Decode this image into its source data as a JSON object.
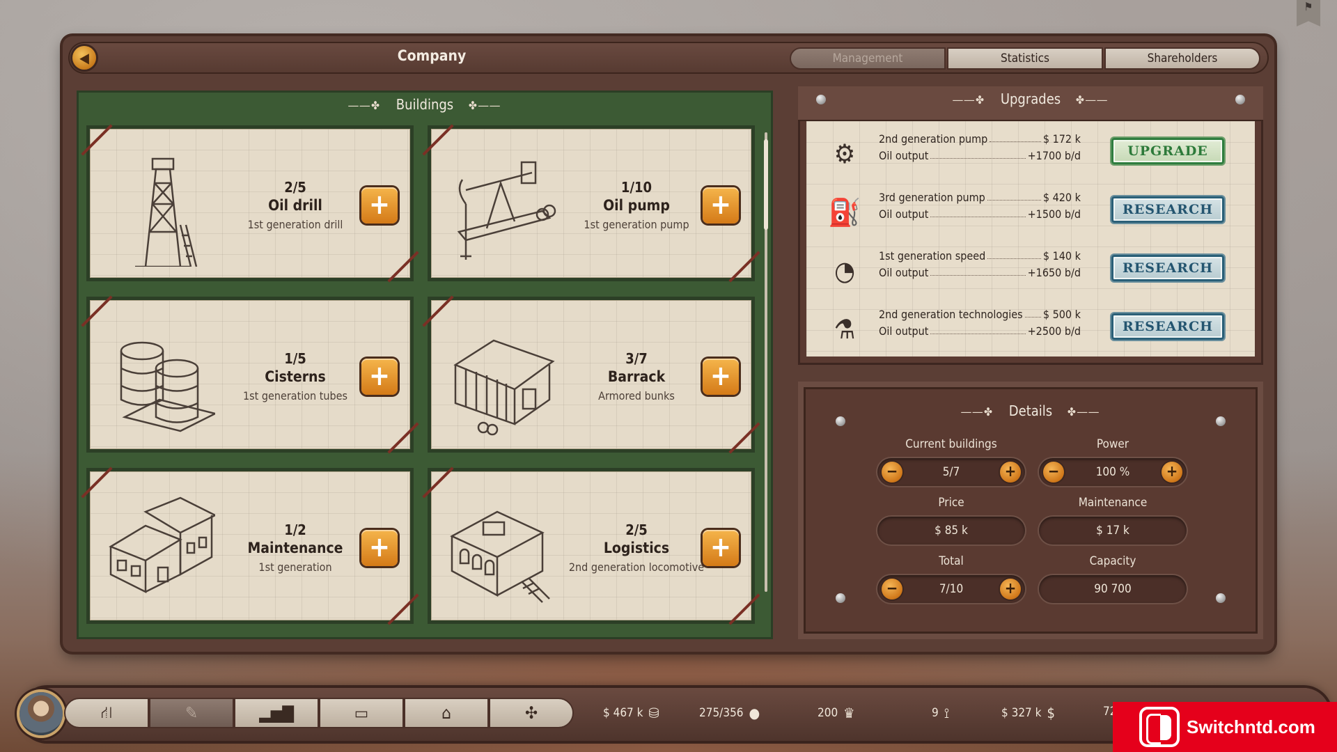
{
  "window": {
    "title": "Company",
    "back_icon": "back-arrow-icon",
    "tabs": [
      {
        "label": "Management",
        "active": true
      },
      {
        "label": "Statistics",
        "active": false
      },
      {
        "label": "Shareholders",
        "active": false
      }
    ]
  },
  "buildings": {
    "heading": "Buildings",
    "cards": [
      {
        "count": "2/5",
        "name": "Oil drill",
        "sub": "1st generation drill",
        "icon": "oil-drill-tower-icon"
      },
      {
        "count": "1/10",
        "name": "Oil pump",
        "sub": "1st generation pump",
        "icon": "pumpjack-icon"
      },
      {
        "count": "1/5",
        "name": "Cisterns",
        "sub": "1st generation tubes",
        "icon": "cistern-tanks-icon"
      },
      {
        "count": "3/7",
        "name": "Barrack",
        "sub": "Armored bunks",
        "icon": "barrack-building-icon"
      },
      {
        "count": "1/2",
        "name": "Maintenance",
        "sub": "1st generation",
        "icon": "maintenance-house-icon"
      },
      {
        "count": "2/5",
        "name": "Logistics",
        "sub": "2nd generation locomotive",
        "icon": "logistics-station-icon"
      }
    ]
  },
  "upgrades": {
    "heading": "Upgrades",
    "rows": [
      {
        "title": "2nd generation pump",
        "cost": "$ 172 k",
        "output_label": "Oil output",
        "output": "+1700 b/d",
        "button": "UPGRADE",
        "icon": "gears-icon"
      },
      {
        "title": "3rd generation pump",
        "cost": "$ 420 k",
        "output_label": "Oil output",
        "output": "+1500 b/d",
        "button": "RESEARCH",
        "icon": "pump-icon"
      },
      {
        "title": "1st generation speed",
        "cost": "$ 140 k",
        "output_label": "Oil output",
        "output": "+1650 b/d",
        "button": "RESEARCH",
        "icon": "speedometer-icon"
      },
      {
        "title": "2nd generation technologies",
        "cost": "$ 500 k",
        "output_label": "Oil output",
        "output": "+2500 b/d",
        "button": "RESEARCH",
        "icon": "microscope-icon"
      }
    ]
  },
  "details": {
    "heading": "Details",
    "current_buildings": {
      "label": "Current buildings",
      "value": "5/7"
    },
    "power": {
      "label": "Power",
      "value": "100 %"
    },
    "price": {
      "label": "Price",
      "value": "$ 85 k"
    },
    "maintenance": {
      "label": "Maintenance",
      "value": "$ 17 k"
    },
    "total": {
      "label": "Total",
      "value": "7/10"
    },
    "capacity": {
      "label": "Capacity",
      "value": "90 700"
    }
  },
  "bottom_bar": {
    "nav": [
      {
        "icon": "map-route-icon",
        "active": false
      },
      {
        "icon": "contract-pen-icon",
        "active": true
      },
      {
        "icon": "bar-chart-icon",
        "active": false
      },
      {
        "icon": "train-car-icon",
        "active": false
      },
      {
        "icon": "bank-icon",
        "active": false
      },
      {
        "icon": "network-nodes-icon",
        "active": false
      }
    ],
    "stats": [
      {
        "value": "$ 467 k",
        "icon": "coins-icon"
      },
      {
        "value": "275/356",
        "icon": "oil-drop-icon"
      },
      {
        "value": "200",
        "icon": "crown-icon"
      },
      {
        "value": "9",
        "icon": "tower-icon"
      },
      {
        "value": "$ 327 k",
        "icon": "dollar-icon"
      },
      {
        "value": "72",
        "icon": ""
      }
    ]
  },
  "watermark": {
    "text": "Switchntd.com"
  },
  "colors": {
    "accent_orange": "#e08a24",
    "panel_green": "#3c5a34",
    "panel_brown": "#5a3a31",
    "paper": "#e5dbc9",
    "research_blue": "#245570",
    "upgrade_green": "#2d7a3a",
    "watermark_red": "#e5001b"
  }
}
